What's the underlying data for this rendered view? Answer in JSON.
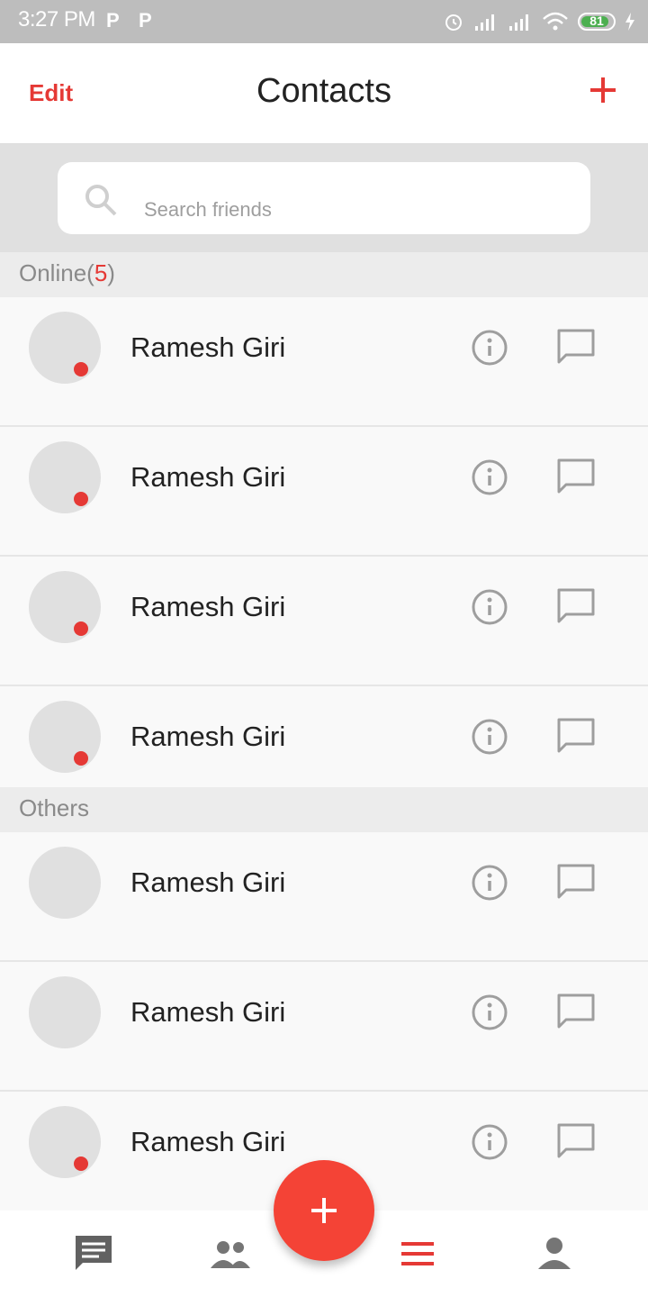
{
  "status_bar": {
    "time": "3:27 PM",
    "notif_1": "P",
    "notif_2": "P",
    "battery": "81"
  },
  "header": {
    "edit_label": "Edit",
    "title": "Contacts"
  },
  "search": {
    "placeholder": "Search friends"
  },
  "sections": {
    "online": {
      "label": "Online",
      "open_paren": "(",
      "count": "5",
      "close_paren": ")"
    },
    "others": {
      "label": "Others"
    }
  },
  "contacts": [
    {
      "name": "Ramesh Giri",
      "online": true
    },
    {
      "name": "Ramesh Giri",
      "online": true
    },
    {
      "name": "Ramesh Giri",
      "online": true
    },
    {
      "name": "Ramesh Giri",
      "online": true
    },
    {
      "name": "Ramesh Giri",
      "online": false
    },
    {
      "name": "Ramesh Giri",
      "online": false
    },
    {
      "name": "Ramesh Giri",
      "online": true
    }
  ],
  "colors": {
    "accent": "#f44336",
    "icon_gray": "#9e9e9e"
  },
  "bottom_nav": [
    "chat-icon",
    "group-icon",
    "menu-icon",
    "person-icon"
  ]
}
